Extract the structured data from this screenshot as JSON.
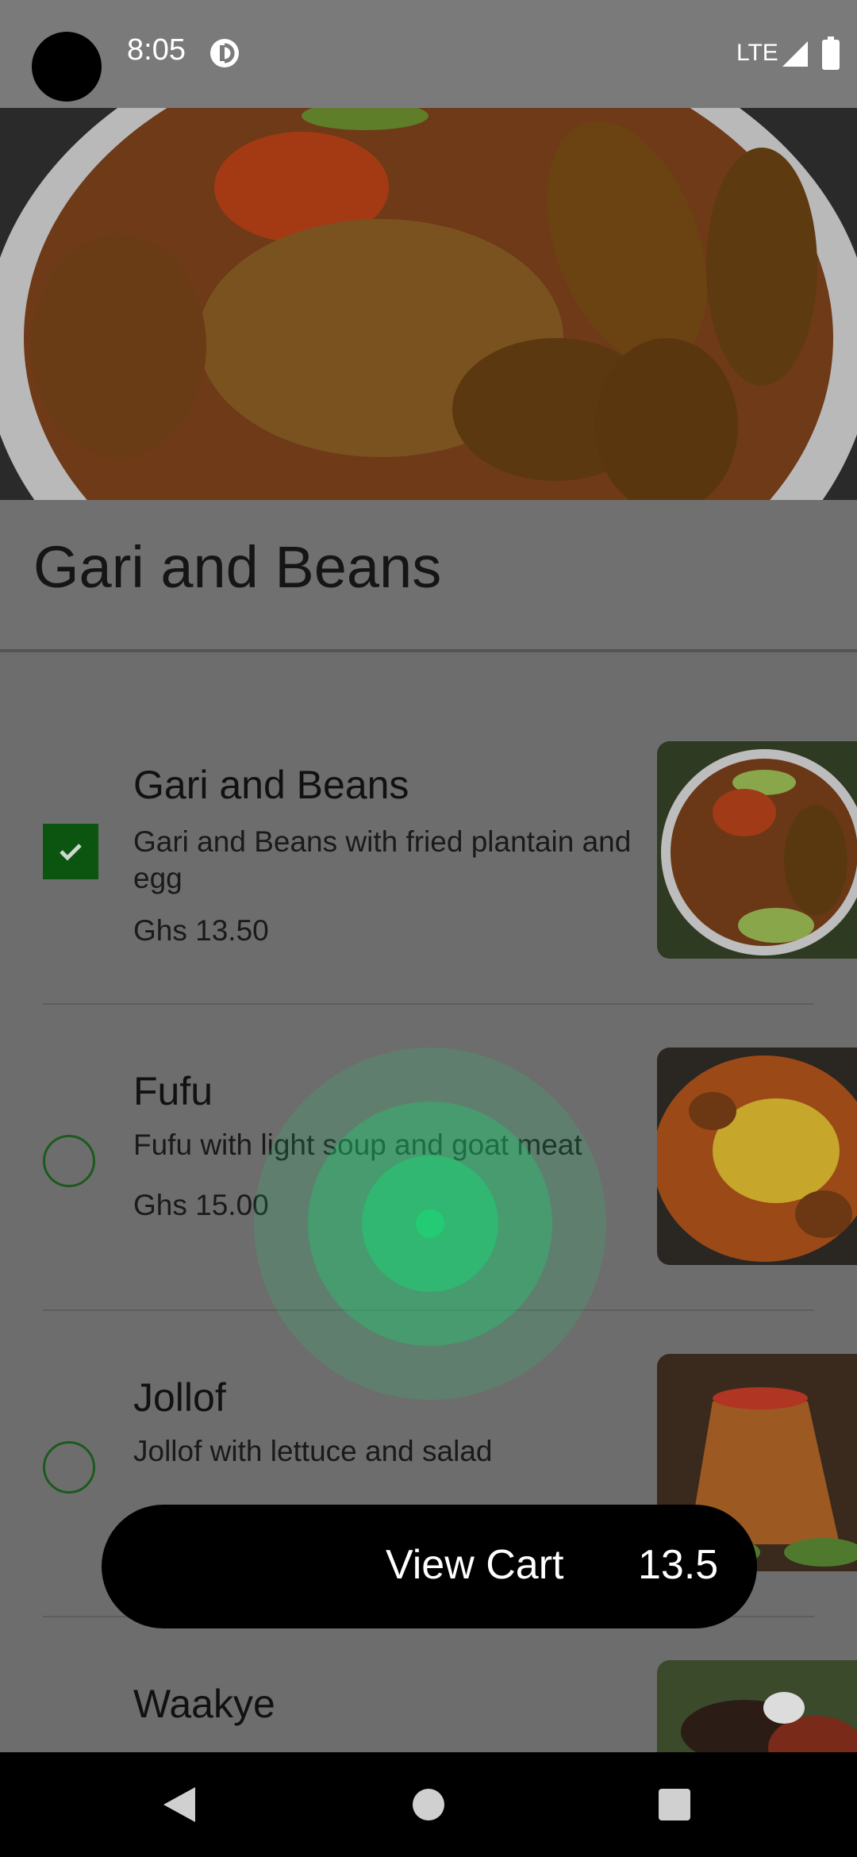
{
  "status_bar": {
    "time": "8:05",
    "network": "LTE",
    "icons": [
      "camera-cutout",
      "app-indicator-icon",
      "signal-icon",
      "battery-icon"
    ]
  },
  "page": {
    "title": "Gari and Beans"
  },
  "menu": {
    "items": [
      {
        "name": "Gari and Beans",
        "description": "Gari and Beans with fried plantain and egg",
        "price": "Ghs 13.50",
        "selected": true
      },
      {
        "name": "Fufu",
        "description": "Fufu with light soup and goat meat",
        "price": "Ghs 15.00",
        "selected": false
      },
      {
        "name": "Jollof",
        "description": "Jollof with lettuce and salad",
        "price": "",
        "selected": false
      },
      {
        "name": "Waakye",
        "description": "",
        "price": "",
        "selected": false
      }
    ]
  },
  "cart": {
    "label": "View Cart",
    "total": "13.5"
  },
  "colors": {
    "accent_green": "#0b5510",
    "ripple_green": "#1fcf74",
    "button_bg": "#000000"
  },
  "nav_bar": {
    "buttons": [
      "back-icon",
      "home-icon",
      "recents-icon"
    ]
  }
}
